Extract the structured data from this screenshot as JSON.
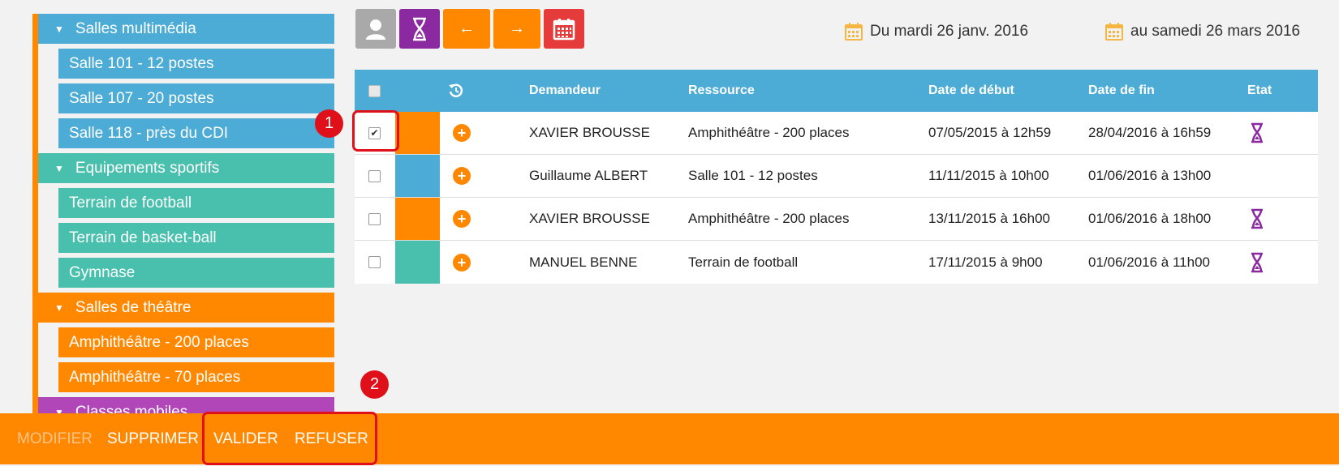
{
  "sidebar": {
    "groups": [
      {
        "label": "Salles multimédia",
        "items": [
          "Salle 101 - 12 postes",
          "Salle 107 - 20 postes",
          "Salle 118 - près du CDI"
        ]
      },
      {
        "label": "Equipements sportifs",
        "items": [
          "Terrain de football",
          "Terrain de basket-ball",
          "Gymnase"
        ]
      },
      {
        "label": "Salles de théâtre",
        "items": [
          "Amphithéâtre - 200 places",
          "Amphithéâtre - 70 places"
        ]
      },
      {
        "label": "Classes mobiles",
        "items": []
      }
    ]
  },
  "toolbar": {
    "user_icon": "user-icon",
    "hourglass_icon": "hourglass-icon",
    "prev_label": "←",
    "next_label": "→",
    "calendar_icon": "calendar-icon"
  },
  "date_range": {
    "from": "Du mardi 26 janv. 2016",
    "to": "au samedi 26 mars 2016"
  },
  "table": {
    "headers": {
      "history_icon": "history-icon",
      "requester": "Demandeur",
      "resource": "Ressource",
      "start": "Date de début",
      "end": "Date de fin",
      "status": "Etat"
    },
    "rows": [
      {
        "checked": true,
        "color": "#ff8800",
        "requester": "XAVIER BROUSSE",
        "resource": "Amphithéâtre - 200 places",
        "start": "07/05/2015 à 12h59",
        "end": "28/04/2016 à 16h59",
        "status_icon": "hourglass-icon"
      },
      {
        "checked": false,
        "color": "#4cacd6",
        "requester": "Guillaume ALBERT",
        "resource": "Salle 101 - 12 postes",
        "start": "11/11/2015 à 10h00",
        "end": "01/06/2016 à 13h00",
        "status_icon": ""
      },
      {
        "checked": false,
        "color": "#ff8800",
        "requester": "XAVIER BROUSSE",
        "resource": "Amphithéâtre - 200 places",
        "start": "13/11/2015 à 16h00",
        "end": "01/06/2016 à 18h00",
        "status_icon": "hourglass-icon"
      },
      {
        "checked": false,
        "color": "#49bfae",
        "requester": "MANUEL BENNE",
        "resource": "Terrain de football",
        "start": "17/11/2015 à 9h00",
        "end": "01/06/2016 à 11h00",
        "status_icon": "hourglass-icon"
      }
    ]
  },
  "markers": {
    "one": "1",
    "two": "2"
  },
  "actions": {
    "modify": "MODIFIER",
    "delete": "SUPPRIMER",
    "validate": "VALIDER",
    "refuse": "REFUSER"
  },
  "colors": {
    "orange": "#ff8800",
    "blue": "#4cacd6",
    "teal": "#49bfae",
    "purple": "#8b2aa0",
    "red": "#e53b3b",
    "highlight": "#e0101a"
  }
}
